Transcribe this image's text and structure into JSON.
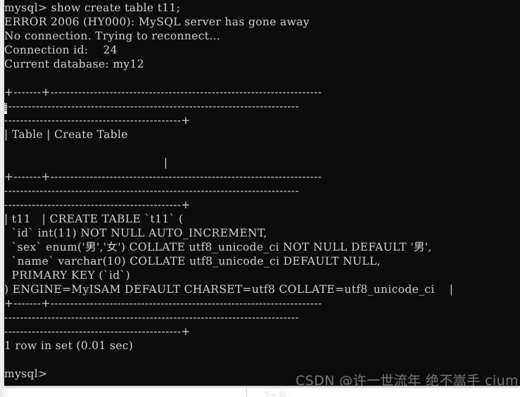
{
  "window": {
    "kind": "mysql-terminal",
    "background_color": "#0c0c0c",
    "foreground_color": "#cfd2d4",
    "prompt": "mysql>"
  },
  "terminal": {
    "lines": [
      "mysql> show create table t11;",
      "ERROR 2006 (HY000): MySQL server has gone away",
      "No connection. Trying to reconnect...",
      "Connection id:    24",
      "Current database: my12",
      "",
      "+-------+---------------------------------------------------------------------",
      "---------------------------------------------------------------------------",
      "---------------------------------------------+",
      "| Table | Create Table",
      "",
      "                                           |",
      "+-------+---------------------------------------------------------------------",
      "---------------------------------------------------------------------------",
      "---------------------------------------------+",
      "| t11   | CREATE TABLE `t11` (",
      "  `id` int(11) NOT NULL AUTO_INCREMENT,",
      "  `sex` enum('男','女') COLLATE utf8_unicode_ci NOT NULL DEFAULT '男',",
      "  `name` varchar(10) COLLATE utf8_unicode_ci DEFAULT NULL,",
      "  PRIMARY KEY (`id`)",
      ") ENGINE=MyISAM DEFAULT CHARSET=utf8 COLLATE=utf8_unicode_ci    |",
      "+-------+---------------------------------------------------------------------",
      "---------------------------------------------------------------------------",
      "---------------------------------------------+",
      "1 row in set (0.01 sec)",
      "",
      "mysql>"
    ]
  },
  "command": {
    "text": "show create table t11;"
  },
  "error": {
    "code": "ERROR 2006",
    "sqlstate": "(HY000)",
    "message": "MySQL server has gone away",
    "reconnect_notice": "No connection. Trying to reconnect...",
    "connection_id": "24",
    "current_database": "my12"
  },
  "result_table": {
    "columns": [
      "Table",
      "Create Table"
    ],
    "rows": [
      {
        "Table": "t11",
        "Create Table": "CREATE TABLE `t11` (\n  `id` int(11) NOT NULL AUTO_INCREMENT,\n  `sex` enum('男','女') COLLATE utf8_unicode_ci NOT NULL DEFAULT '男',\n  `name` varchar(10) COLLATE utf8_unicode_ci DEFAULT NULL,\n  PRIMARY KEY (`id`)\n) ENGINE=MyISAM DEFAULT CHARSET=utf8 COLLATE=utf8_unicode_ci"
      }
    ],
    "footer": "1 row in set (0.01 sec)"
  },
  "watermark": {
    "text": "CSDN @许一世流年 绝不嵩手 cium",
    "color": "#d7dadc"
  },
  "page": {
    "clipped_glyph": "自",
    "faint_text": "下一篇："
  }
}
